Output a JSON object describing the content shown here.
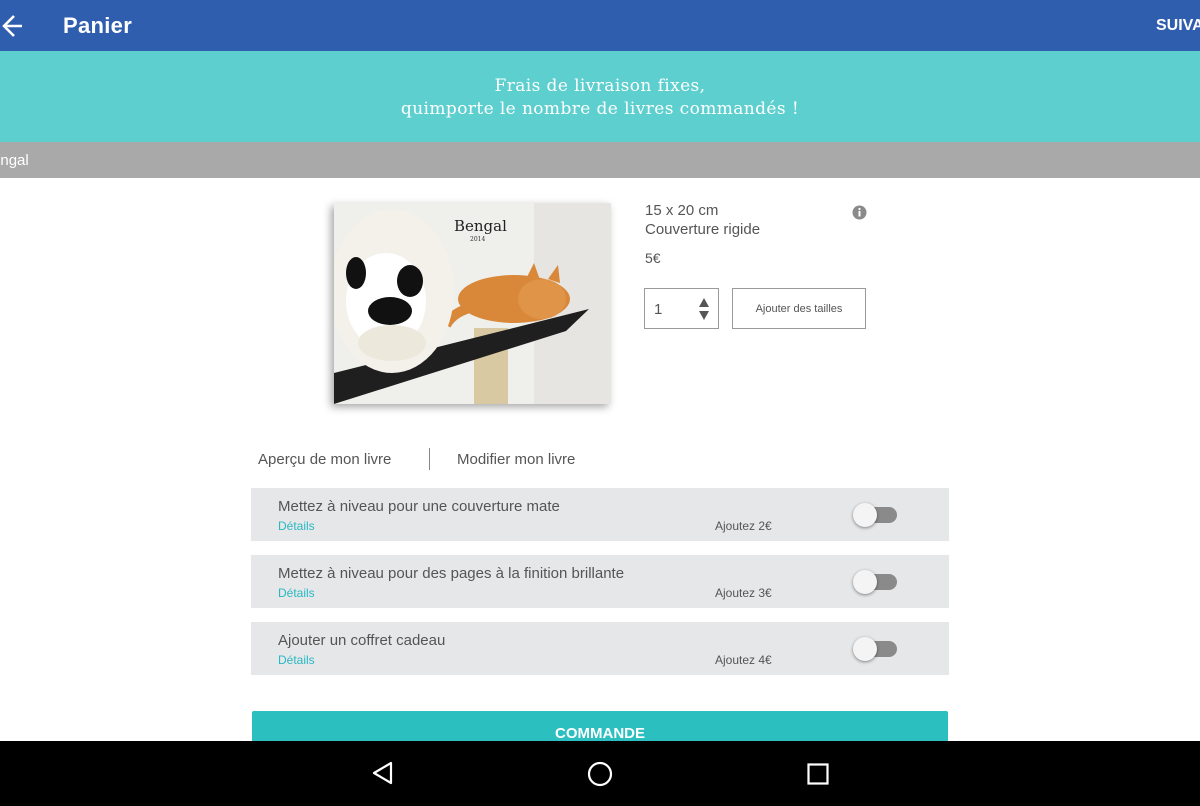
{
  "appbar": {
    "title": "Panier",
    "action": "SUIVANT"
  },
  "promo": {
    "line1": "Frais de livraison fixes,",
    "line2": "quimporte le nombre de livres commandés !"
  },
  "section": {
    "title": "Bengal"
  },
  "book": {
    "cover_title": "Bengal",
    "cover_year": "2014",
    "size": "15 x 20 cm",
    "cover_type": "Couverture rigide",
    "price": "5€",
    "quantity": "1",
    "add_sizes_label": "Ajouter des tailles"
  },
  "links": {
    "preview": "Aperçu de mon livre",
    "edit": "Modifier mon livre"
  },
  "options": [
    {
      "label": "Mettez à niveau pour une couverture mate",
      "details": "Détails",
      "price": "Ajoutez 2€",
      "enabled": false
    },
    {
      "label": "Mettez à niveau pour des pages à la finition brillante",
      "details": "Détails",
      "price": "Ajoutez 3€",
      "enabled": false
    },
    {
      "label": "Ajouter un coffret cadeau",
      "details": "Détails",
      "price": "Ajoutez 4€",
      "enabled": false
    }
  ],
  "order_button": "COMMANDE",
  "colors": {
    "appbar": "#2f5eae",
    "promo": "#5ecfcf",
    "accent": "#2bbfc0",
    "link": "#29b8c3"
  },
  "icons": {
    "back": "arrow-left-icon",
    "info": "info-icon",
    "nav_back": "triangle-back-icon",
    "nav_home": "circle-home-icon",
    "nav_recent": "square-recent-icon"
  }
}
